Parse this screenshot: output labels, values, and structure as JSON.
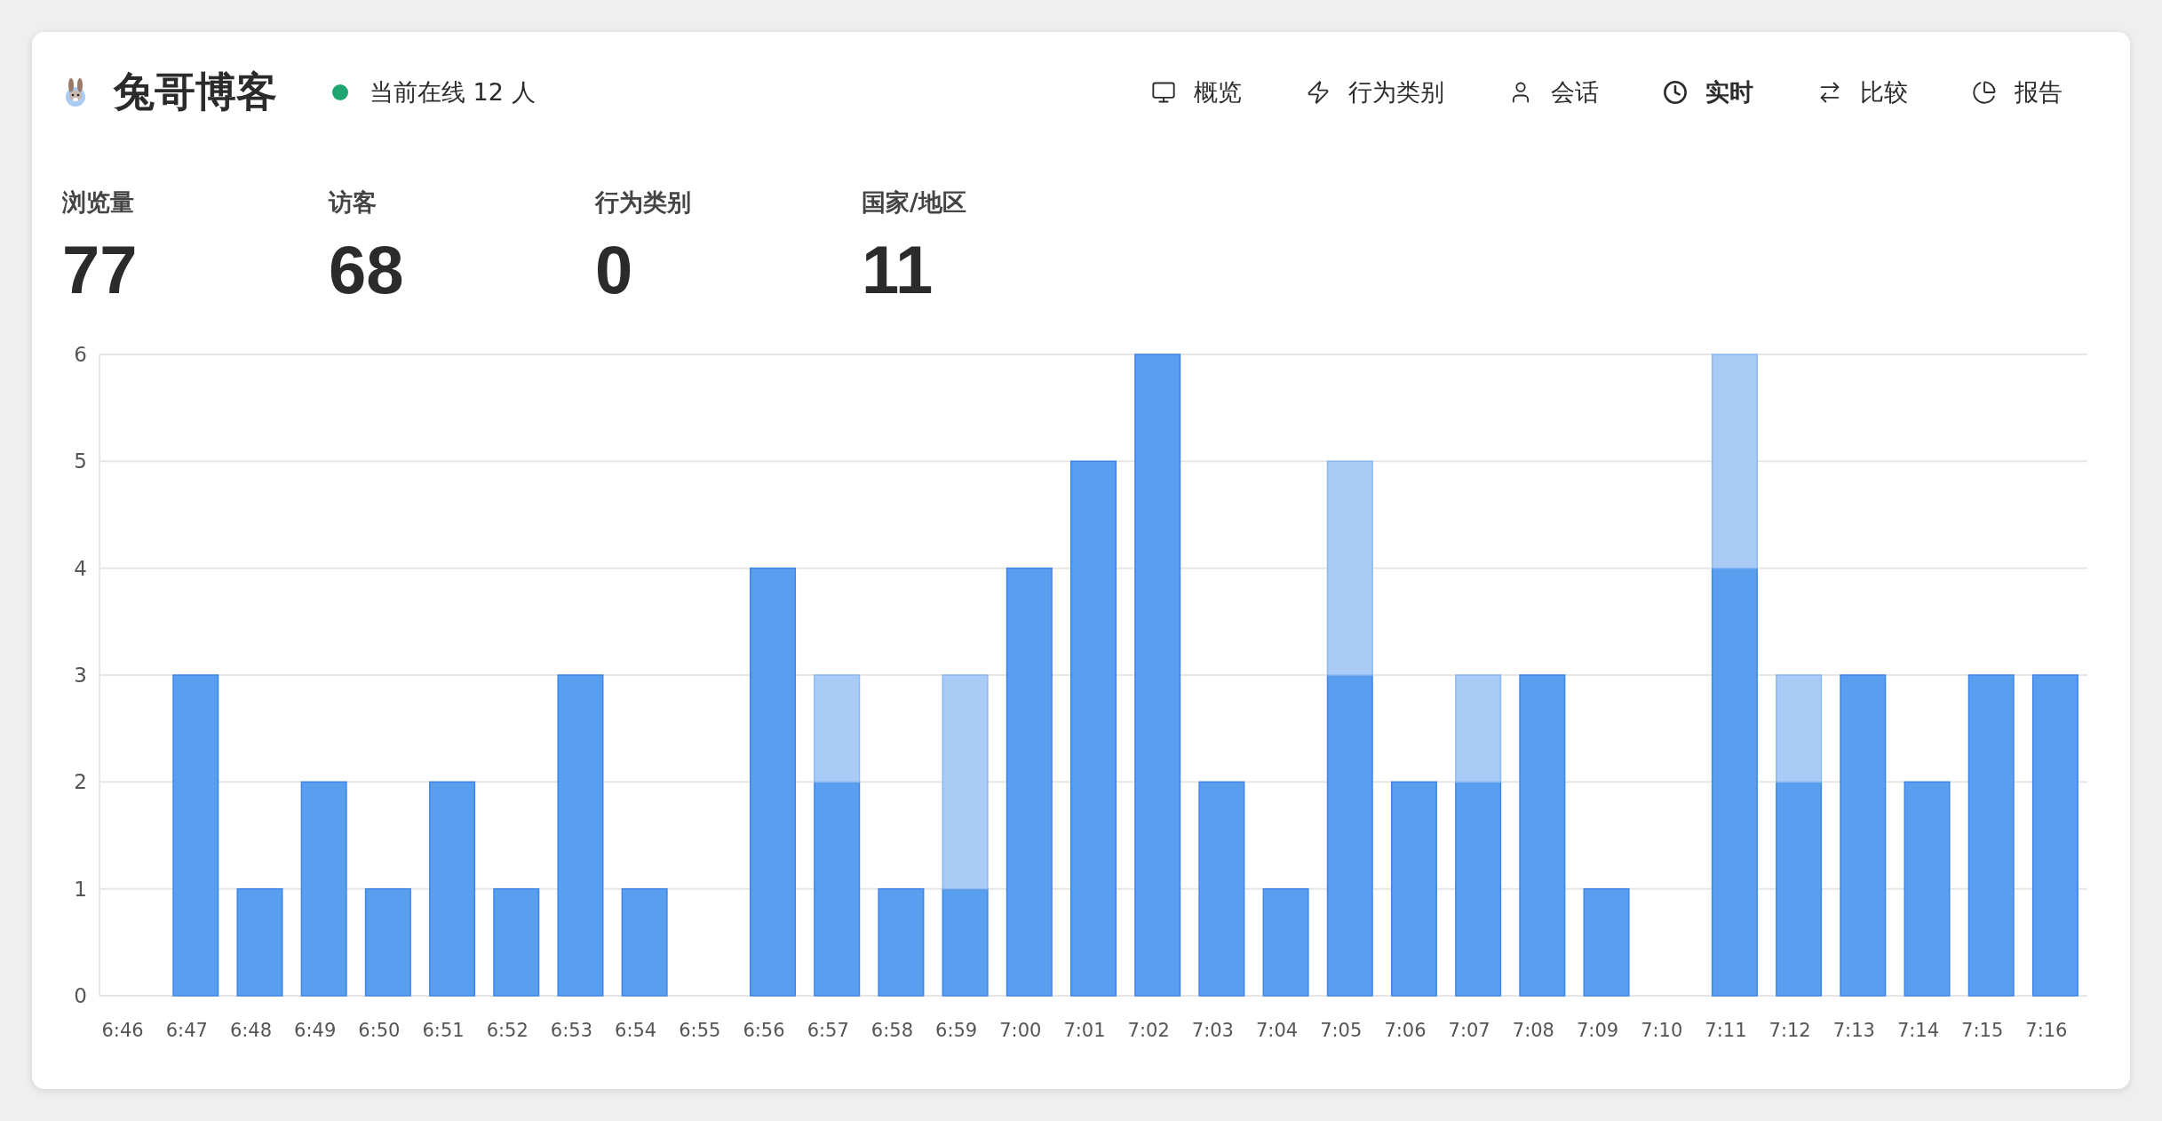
{
  "header": {
    "title": "兔哥博客",
    "online": {
      "text": "当前在线 12 人",
      "color": "#1ea672"
    }
  },
  "nav": [
    {
      "label": "概览",
      "selected": false
    },
    {
      "label": "行为类别",
      "selected": false
    },
    {
      "label": "会话",
      "selected": false
    },
    {
      "label": "实时",
      "selected": true
    },
    {
      "label": "比较",
      "selected": false
    },
    {
      "label": "报告",
      "selected": false
    }
  ],
  "stats": [
    {
      "label": "浏览量",
      "value": "77"
    },
    {
      "label": "访客",
      "value": "68"
    },
    {
      "label": "行为类别",
      "value": "0"
    },
    {
      "label": "国家/地区",
      "value": "11"
    }
  ],
  "chart_data": {
    "type": "bar",
    "stacked": true,
    "grid": true,
    "categories": [
      "6:46",
      "6:47",
      "6:48",
      "6:49",
      "6:50",
      "6:51",
      "6:52",
      "6:53",
      "6:54",
      "6:55",
      "6:56",
      "6:57",
      "6:58",
      "6:59",
      "7:00",
      "7:01",
      "7:02",
      "7:03",
      "7:04",
      "7:05",
      "7:06",
      "7:07",
      "7:08",
      "7:09",
      "7:10",
      "7:11",
      "7:12",
      "7:13",
      "7:14",
      "7:15",
      "7:16"
    ],
    "ylim": [
      0,
      6
    ],
    "yticks": [
      0,
      1,
      2,
      3,
      4,
      5,
      6
    ],
    "series": [
      {
        "color": "#5a9ef0",
        "values": [
          0,
          3,
          1,
          2,
          1,
          2,
          1,
          3,
          1,
          0,
          4,
          2,
          1,
          1,
          4,
          5,
          6,
          2,
          1,
          3,
          2,
          2,
          3,
          1,
          0,
          4,
          2,
          3,
          2,
          3,
          3
        ]
      },
      {
        "color": "#a9cbf6",
        "values": [
          0,
          0,
          0,
          0,
          0,
          0,
          0,
          0,
          0,
          0,
          0,
          1,
          0,
          2,
          0,
          0,
          0,
          0,
          0,
          2,
          0,
          1,
          0,
          0,
          0,
          2,
          1,
          0,
          0,
          0,
          0
        ]
      }
    ]
  }
}
